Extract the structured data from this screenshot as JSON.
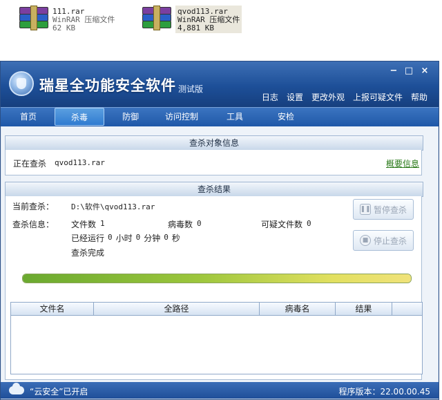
{
  "desktop": {
    "files": [
      {
        "name": "111.rar",
        "type": "WinRAR 压缩文件",
        "size": "62 KB"
      },
      {
        "name": "qvod113.rar",
        "type": "WinRAR 压缩文件",
        "size": "4,881 KB"
      }
    ]
  },
  "window": {
    "title": "瑞星全功能安全软件",
    "edition": "测试版",
    "controls": {
      "minimize": "−",
      "maximize": "□",
      "close": "×"
    },
    "menu": [
      "日志",
      "设置",
      "更改外观",
      "上报可疑文件",
      "帮助"
    ],
    "tabs": [
      "首页",
      "杀毒",
      "防御",
      "访问控制",
      "工具",
      "安检"
    ],
    "active_tab": "杀毒"
  },
  "target_panel": {
    "title": "查杀对象信息",
    "scanning_label": "正在查杀",
    "scanning_file": "qvod113.rar",
    "summary_link": "概要信息"
  },
  "results_panel": {
    "title": "查杀结果",
    "current_label": "当前查杀：",
    "current_path": "D:\\软件\\qvod113.rar",
    "info_label": "查杀信息：",
    "files_count_label": "文件数",
    "files_count": "1",
    "virus_count_label": "病毒数",
    "virus_count": "0",
    "suspicious_label": "可疑文件数",
    "suspicious_count": "0",
    "elapsed_prefix": "已经运行",
    "elapsed_hours": "0",
    "hours_unit": "小时",
    "elapsed_minutes": "0",
    "minutes_unit": "分钟",
    "elapsed_seconds": "0",
    "seconds_unit": "秒",
    "status_text": "查杀完成",
    "pause_button": "暂停查杀",
    "stop_button": "停止查杀",
    "progress_percent": 100
  },
  "results_table": {
    "columns": [
      "文件名",
      "全路径",
      "病毒名",
      "结果"
    ],
    "rows": []
  },
  "statusbar": {
    "cloud_status": "“云安全”已开启",
    "version_label": "程序版本：22.00.00.45"
  }
}
